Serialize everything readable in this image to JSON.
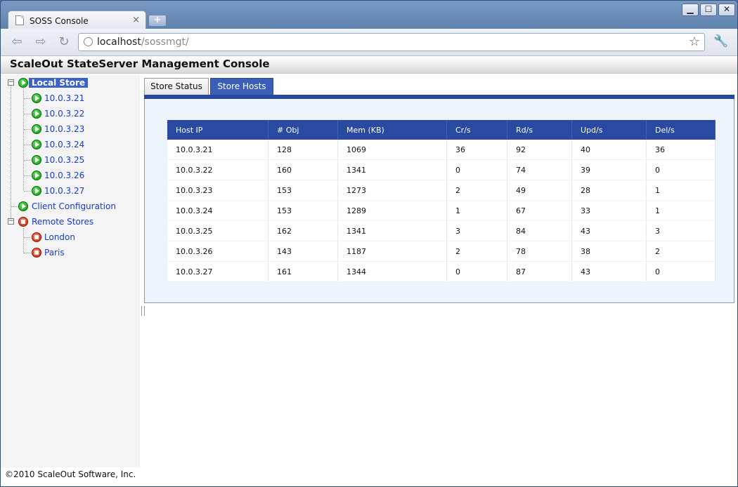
{
  "browser": {
    "tab_title": "SOSS Console",
    "tab_close": "×",
    "new_tab": "+",
    "url_host": "localhost",
    "url_path": "/sossmgt/",
    "window_controls": {
      "minimize": "▁",
      "maximize": "☐",
      "close": "✕"
    },
    "nav": {
      "back": "⇦",
      "forward": "⇨",
      "reload": "↻"
    },
    "bookmark": "☆",
    "wrench": "🔧"
  },
  "page": {
    "title": "ScaleOut StateServer Management Console",
    "footer": "©2010 ScaleOut Software, Inc."
  },
  "tree": {
    "local_store": {
      "label": "Local Store",
      "status": "running",
      "hosts": [
        "10.0.3.21",
        "10.0.3.22",
        "10.0.3.23",
        "10.0.3.24",
        "10.0.3.25",
        "10.0.3.26",
        "10.0.3.27"
      ]
    },
    "client_configuration": {
      "label": "Client Configuration",
      "status": "running"
    },
    "remote_stores": {
      "label": "Remote Stores",
      "status": "stopped",
      "stores": [
        "London",
        "Paris"
      ]
    }
  },
  "tabs": [
    {
      "label": "Store Status",
      "active": false
    },
    {
      "label": "Store Hosts",
      "active": true
    }
  ],
  "hosts_table": {
    "columns": [
      "Host IP",
      "# Obj",
      "Mem (KB)",
      "Cr/s",
      "Rd/s",
      "Upd/s",
      "Del/s"
    ],
    "rows": [
      [
        "10.0.3.21",
        "128",
        "1069",
        "36",
        "92",
        "40",
        "36"
      ],
      [
        "10.0.3.22",
        "160",
        "1341",
        "0",
        "74",
        "39",
        "0"
      ],
      [
        "10.0.3.23",
        "153",
        "1273",
        "2",
        "49",
        "28",
        "1"
      ],
      [
        "10.0.3.24",
        "153",
        "1289",
        "1",
        "67",
        "33",
        "1"
      ],
      [
        "10.0.3.25",
        "162",
        "1341",
        "3",
        "84",
        "43",
        "3"
      ],
      [
        "10.0.3.26",
        "143",
        "1187",
        "2",
        "78",
        "38",
        "2"
      ],
      [
        "10.0.3.27",
        "161",
        "1344",
        "0",
        "87",
        "43",
        "0"
      ]
    ]
  },
  "colors": {
    "accent": "#2a4aa2",
    "running": "#0b9a0b",
    "stopped": "#d8200a",
    "link": "#1a3bd0"
  }
}
